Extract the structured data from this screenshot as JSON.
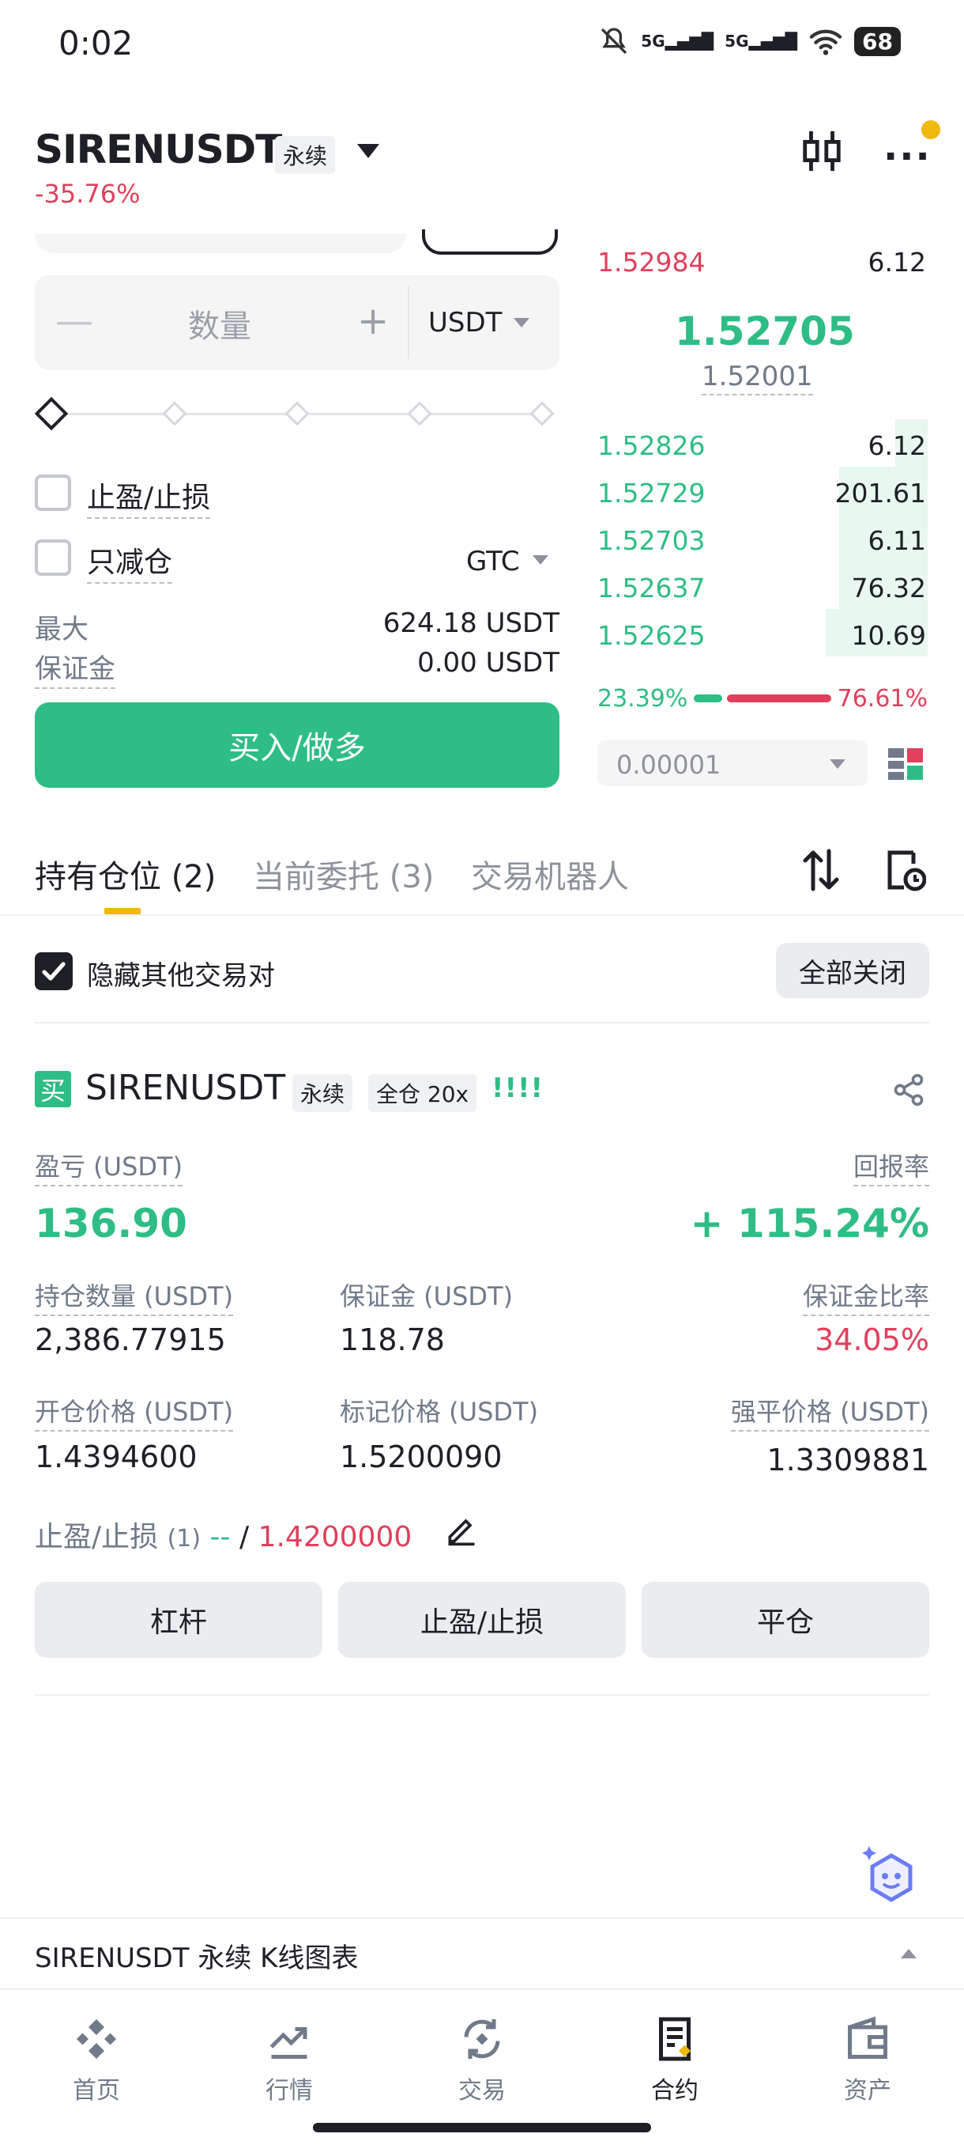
{
  "status_bar": {
    "time": "0:02",
    "signal1": "5G",
    "signal2": "5G",
    "battery": "68"
  },
  "header": {
    "symbol": "SIRENUSDT",
    "contract_type": "永续",
    "change": "-35.76%"
  },
  "order_form": {
    "quantity_placeholder": "数量",
    "unit": "USDT",
    "tpsl_label": "止盈/止损",
    "reduce_only_label": "只减仓",
    "time_in_force": "GTC",
    "max_label": "最大",
    "max_value": "624.18 USDT",
    "margin_label": "保证金",
    "margin_value": "0.00 USDT",
    "buy_button": "买入/做多"
  },
  "order_book": {
    "ask_top": {
      "price": "1.52984",
      "qty": "6.12"
    },
    "last_price": "1.52705",
    "mark_price": "1.52001",
    "bids": [
      {
        "price": "1.52826",
        "qty": "6.12",
        "depth": 0.12
      },
      {
        "price": "1.52729",
        "qty": "201.61",
        "depth": 0.33
      },
      {
        "price": "1.52703",
        "qty": "6.11",
        "depth": 0.33
      },
      {
        "price": "1.52637",
        "qty": "76.32",
        "depth": 0.33
      },
      {
        "price": "1.52625",
        "qty": "10.69",
        "depth": 0.38
      }
    ],
    "buy_ratio": "23.39%",
    "sell_ratio": "76.61%",
    "precision": "0.00001"
  },
  "tabs": {
    "positions": "持有仓位 (2)",
    "open_orders": "当前委托 (3)",
    "bots": "交易机器人"
  },
  "filter": {
    "hide_others": "隐藏其他交易对",
    "close_all": "全部关闭"
  },
  "position": {
    "side_badge": "买",
    "symbol": "SIRENUSDT",
    "contract_type": "永续",
    "margin_mode": "全仓 20x",
    "strength": "!!!!",
    "pnl_label": "盈亏 (USDT)",
    "pnl_value": "136.90",
    "roe_label": "回报率",
    "roe_value": "+ 115.24%",
    "size_label": "持仓数量 (USDT)",
    "size_value": "2,386.77915",
    "margin_label": "保证金 (USDT)",
    "margin_value": "118.78",
    "margin_ratio_label": "保证金比率",
    "margin_ratio_value": "34.05%",
    "entry_label": "开仓价格 (USDT)",
    "entry_value": "1.4394600",
    "mark_label": "标记价格 (USDT)",
    "mark_value": "1.5200090",
    "liq_label": "强平价格 (USDT)",
    "liq_value": "1.3309881",
    "tpsl_label": "止盈/止损",
    "tpsl_count": "(1)",
    "tp_value": "--",
    "separator": "/",
    "sl_value": "1.4200000",
    "btn_leverage": "杠杆",
    "btn_tpsl": "止盈/止损",
    "btn_close": "平仓"
  },
  "kline_bar": {
    "label": "SIRENUSDT 永续 K线图表"
  },
  "bottom_nav": [
    {
      "label": "首页",
      "icon": "home-icon"
    },
    {
      "label": "行情",
      "icon": "markets-icon"
    },
    {
      "label": "交易",
      "icon": "trade-icon"
    },
    {
      "label": "合约",
      "icon": "futures-icon"
    },
    {
      "label": "资产",
      "icon": "wallet-icon"
    }
  ],
  "colors": {
    "green": "#2ebd85",
    "red": "#e0405b",
    "accent": "#f0b90b"
  }
}
